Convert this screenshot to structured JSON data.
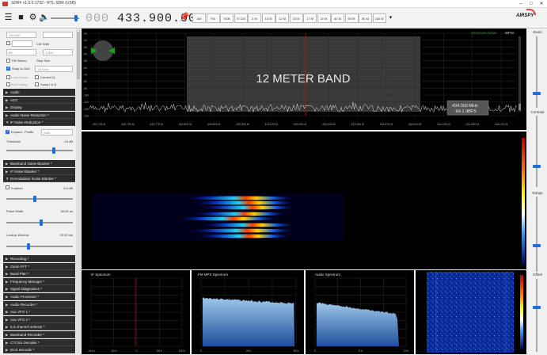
{
  "window": {
    "title": "SDR# v1.0.0.1732 - RTL-SDR (USB)"
  },
  "toolbar": {
    "frequency_dim": "000",
    "frequency": "433.900.000",
    "bands": [
      "AM",
      "FM",
      "SSB",
      "70 CM",
      "2 M",
      "10 M",
      "12 M",
      "15 M",
      "17 M",
      "20 M",
      "40 M",
      "60 M",
      "80 M",
      "160 M"
    ],
    "logo": "AIRSPY"
  },
  "left": {
    "input1": "100.000",
    "input2": "",
    "cw_shift_label": "CW Shift",
    "input3": "69",
    "input4": "1.000",
    "fm_stereo_label": "FM Stereo",
    "step_size_label": "Step Size",
    "snap_label": "Snap to Grid",
    "snap_value": "100 kHz",
    "lock_carrier_label": "Lock Carrier",
    "correct_iq_label": "Correct IQ",
    "anti_fading_label": "Anti-Fading",
    "swap_iq_label": "Swap I & Q",
    "sections1": [
      "Audio",
      "AGC",
      "Display",
      "Audio Noise Reduction *",
      "IF Noise Reduction *"
    ],
    "expand_label": "Expand - Profile",
    "profile_value": "Auto",
    "threshold_label": "Threshold",
    "threshold_value": "-15 dB",
    "sections2": [
      "Baseband Noise Blanker *",
      "IF Noise Blanker *",
      "Demodulator Noise Blanker *"
    ],
    "enabled_label": "Enabled",
    "enabled_value": "6.0 dB",
    "pulse_width_label": "Pulse Width",
    "pulse_width_value": "50.00 us",
    "lookup_label": "Lookup Window",
    "lookup_value": "20.00 ms",
    "sections3": [
      "Recording *",
      "Zoom FFT *",
      "Band Plan *",
      "Frequency Manager *",
      "Signal Diagnostics *",
      "Audio Processor *",
      "Audio Recorder *",
      "Aux VFO 1 *",
      "Aux VFO 2 *",
      "ILS channel selector *",
      "Baseband Recorder *",
      "CTCSS Decoder *",
      "DCS Decoder *"
    ]
  },
  "spectrum": {
    "band_label": "12 METER BAND",
    "status_left": "Shortcuts Active",
    "status_right": "WFM",
    "tooltip_freq": "434.000 MHz",
    "tooltip_dbfs": "-64.1 dBFS",
    "y_ticks": [
      "-10",
      "-20",
      "-30",
      "-40",
      "-50",
      "-60",
      "-70",
      "-80",
      "-90",
      "-100",
      "-110",
      "-120",
      "-130"
    ],
    "x_ticks": [
      "433.725 M",
      "433.750 M",
      "433.775 M",
      "433.800 M",
      "433.825 M",
      "433.850 M",
      "433.875 M",
      "433.900 M",
      "433.925 M",
      "433.950 M",
      "433.975 M",
      "434.000 M",
      "434.025 M",
      "434.050 M",
      "434.075 M"
    ]
  },
  "right": {
    "contrast": "Contrast",
    "zoom": "Zoom",
    "range": "Range",
    "offset": "Offset"
  },
  "bottom": {
    "if_title": "IF Spectrum",
    "if_ticks": [
      "-100 k",
      "-50 k",
      "0",
      "50 k",
      "100 k"
    ],
    "fm_title": "FM MPX Spectrum",
    "fm_ticks": [
      "0",
      "25 k",
      "50 k"
    ],
    "audio_title": "Audio Spectrum",
    "audio_ticks": [
      "0",
      "5 k",
      "10 k"
    ]
  },
  "colors": {
    "accent": "#1e6fd9",
    "section_bg": "#2c2c2c",
    "spectrum_bg": "#000000",
    "marker": "#d01010"
  }
}
